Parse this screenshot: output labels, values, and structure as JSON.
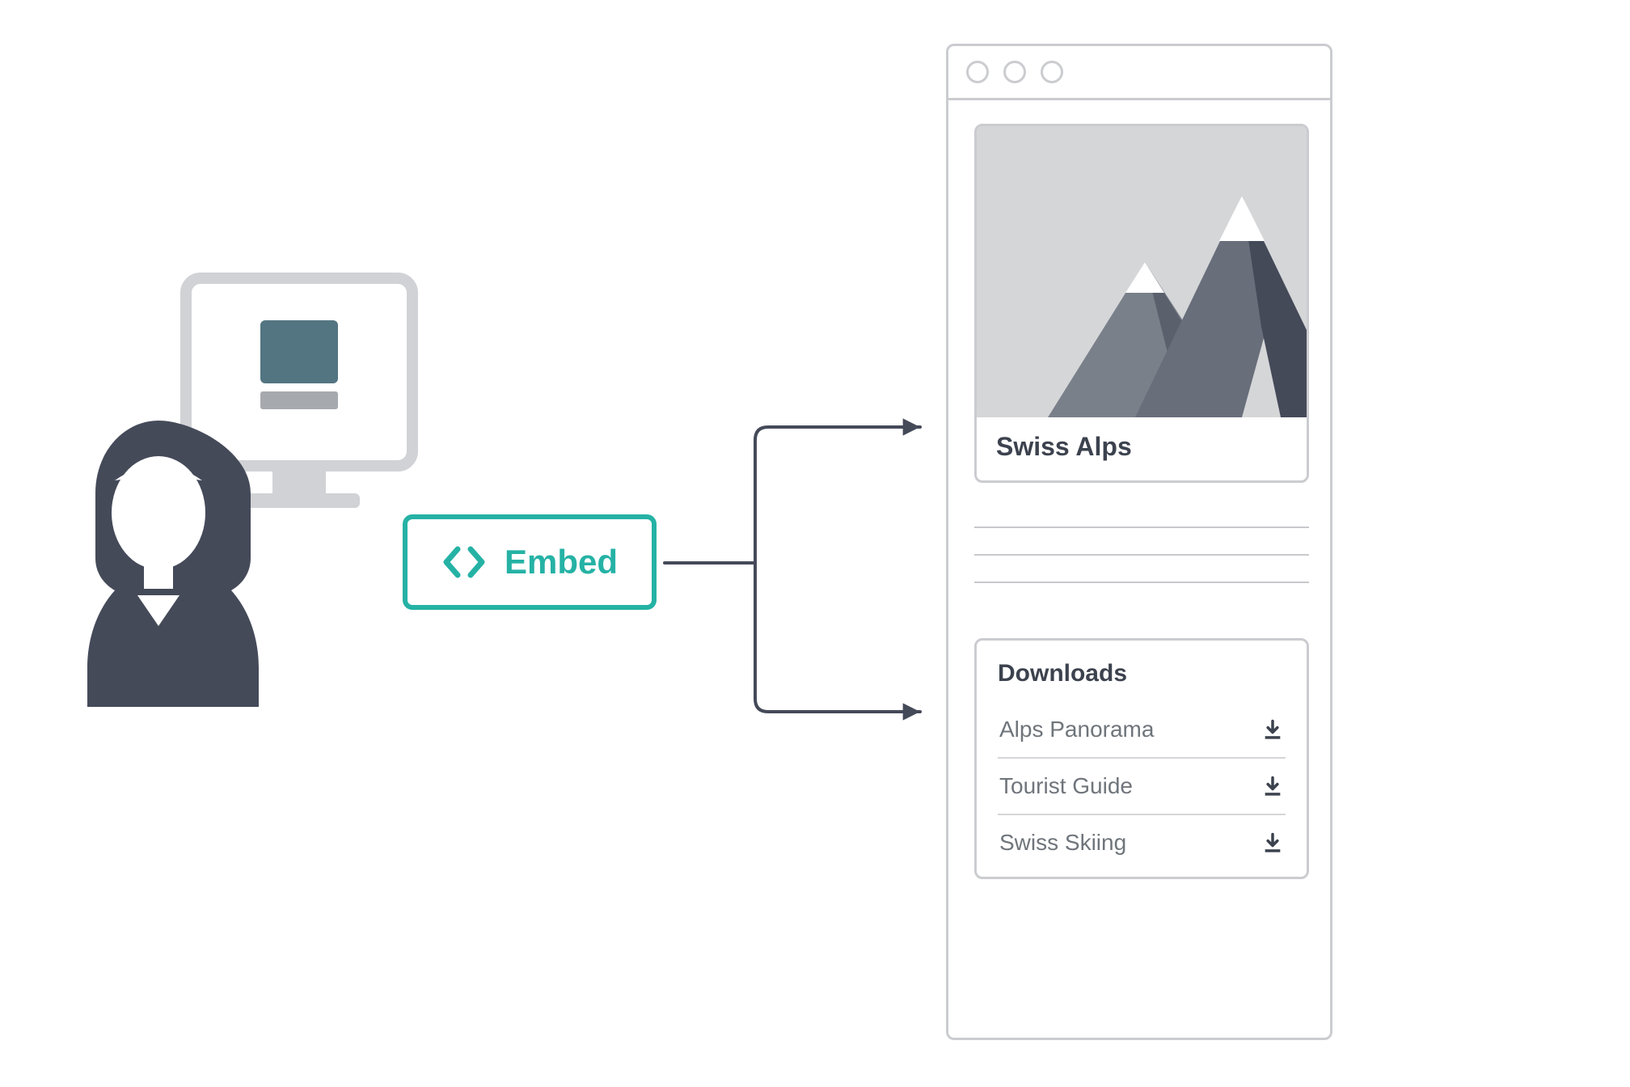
{
  "embed": {
    "label": "Embed"
  },
  "card": {
    "title": "Swiss Alps"
  },
  "downloads": {
    "title": "Downloads",
    "items": [
      "Alps Panorama",
      "Tourist Guide",
      "Swiss Skiing"
    ]
  },
  "colors": {
    "teal": "#25b2a5",
    "slate": "#454a59",
    "outline": "#cbccd0"
  },
  "icons": {
    "user_monitor": "user-at-computer-icon",
    "code": "code-icon",
    "download": "download-icon",
    "browser_dots": "window-controls-icon",
    "mountains": "mountains-illustration"
  }
}
